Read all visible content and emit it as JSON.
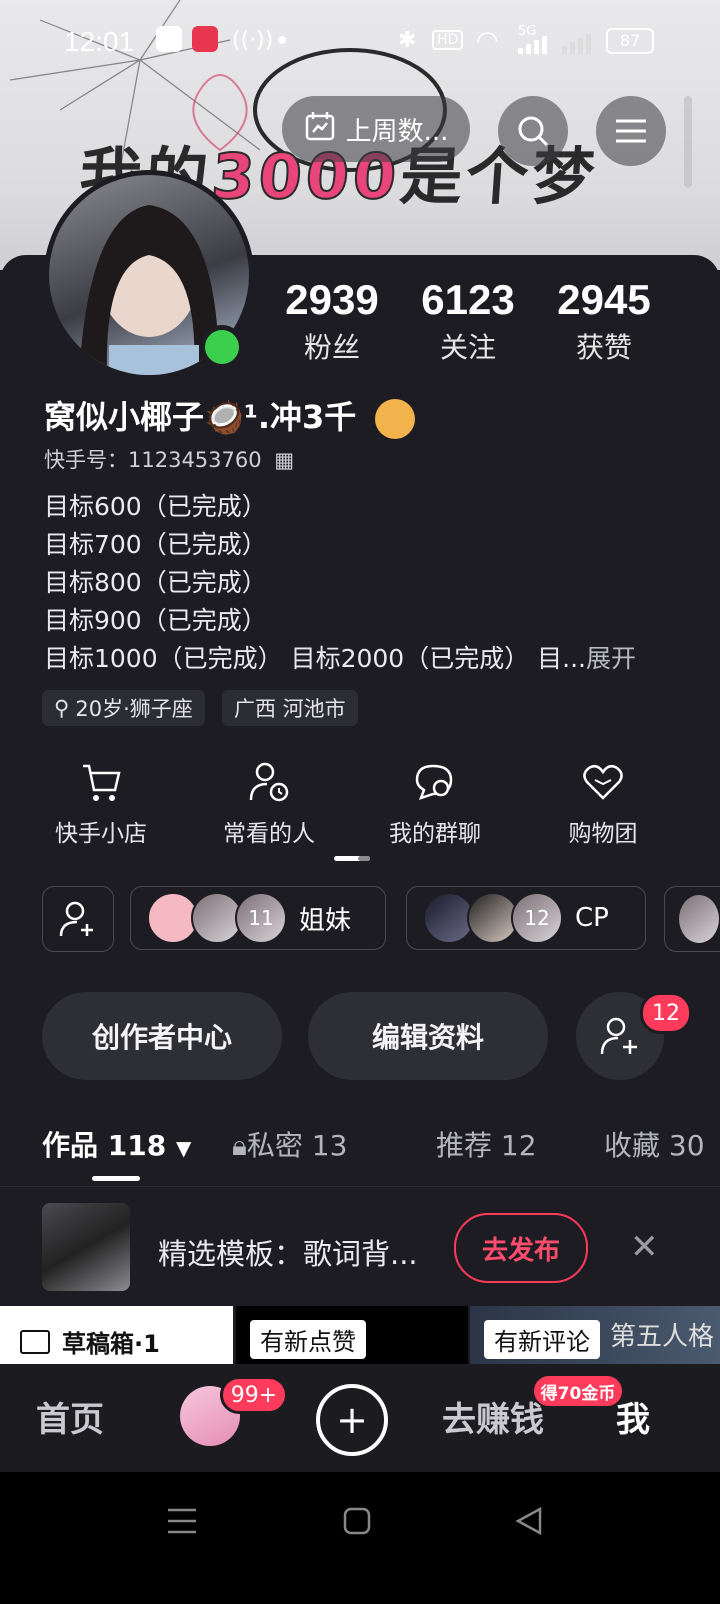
{
  "status_bar": {
    "time": "12:01",
    "battery": "87",
    "network": "5G"
  },
  "header": {
    "banner_text_1": "我的",
    "banner_text_2": "3000",
    "banner_text_3": "是个梦",
    "weekly_btn_label": "上周数...",
    "icons": [
      "calendar-icon",
      "search-icon",
      "menu-icon"
    ]
  },
  "profile": {
    "stats": [
      {
        "value": "2939",
        "label": "粉丝"
      },
      {
        "value": "6123",
        "label": "关注"
      },
      {
        "value": "2945",
        "label": "获赞"
      }
    ],
    "name": "窝似小椰子🥥¹.冲3千",
    "kuaishou_id": "快手号：1123453760",
    "bio_lines": [
      "目标600（已完成）",
      "目标700（已完成）",
      "目标800（已完成）",
      "目标900（已完成）",
      "目标1000（已完成） 目标2000（已完成） 目..."
    ],
    "expand_label": "展开",
    "tags": [
      "20岁·狮子座",
      "广西 河池市"
    ]
  },
  "quick_actions": [
    {
      "label": "快手小店",
      "icon": "cart-icon"
    },
    {
      "label": "常看的人",
      "icon": "user-clock-icon"
    },
    {
      "label": "我的群聊",
      "icon": "chat-icon"
    },
    {
      "label": "购物团",
      "icon": "heart-icon"
    }
  ],
  "groups": [
    {
      "count": "11",
      "label": "姐妹"
    },
    {
      "count": "12",
      "label": "CP"
    }
  ],
  "buttons": {
    "creator_center": "创作者中心",
    "edit_profile": "编辑资料",
    "friend_badge": "12"
  },
  "tabs": [
    {
      "label": "作品 118",
      "active": true
    },
    {
      "label": "私密 13",
      "active": false
    },
    {
      "label": "推荐 12",
      "active": false
    },
    {
      "label": "收藏 30",
      "active": false
    }
  ],
  "promo": {
    "text": "精选模板：歌词背...",
    "action": "去发布"
  },
  "tiles": {
    "draft_label": "草稿箱·1",
    "likes_label": "有新点赞",
    "comments_label": "有新评论",
    "tile_caption": "第五人格"
  },
  "bottom_nav": {
    "home": "首页",
    "message_badge": "99+",
    "earn": "去赚钱",
    "earn_badge": "得70金币",
    "me": "我"
  },
  "colors": {
    "accent": "#ff3b5c",
    "background": "#1c1c22",
    "online": "#3ccf4e"
  }
}
